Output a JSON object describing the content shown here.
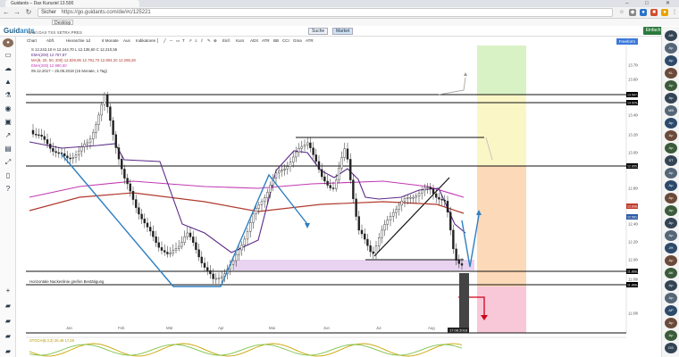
{
  "browser": {
    "tab_title": "Guidants – Dax Kursziel 13.500",
    "url": "https://go.guidants.com/de/#c/125221",
    "secure_label": "Sicher",
    "bookmarks": [
      "Desktop"
    ]
  },
  "site": {
    "logo_a": "Guid",
    "logo_b": "ants",
    "search_label": "Suche",
    "active_button": "Market",
    "login_label": "Einfach Login"
  },
  "chart_window": {
    "title": "Chart DAX TXX XETRA PRES",
    "toolbar": {
      "items": [
        "Chart",
        "Abfl.",
        "Hierarchie",
        "1d",
        "6 Monate",
        "Aus",
        "Indikatoren"
      ],
      "tools": [
        "Einf.",
        "Kurs",
        "ADX",
        "ATR",
        "BB",
        "CCI",
        "Gma",
        "ATR"
      ],
      "freeze_label": "Freeform"
    },
    "legend": [
      "S 12.242,10  H 12.244,70  L 12.135,60  C 12.210,55",
      "EMA(200)  12.757,87",
      "MA(8, 20, 50, 200)  12.829,95  12.791,70  12.804,20  12.286,28",
      "EMA(200)  12.990,50",
      "09.12.2017 – 25.08.2018  (15 Monate, 1 Tag)"
    ],
    "annotation": "Horizontale Nackenlinie greifen Bestätigung",
    "date_labels": [
      "Jan",
      "Feb",
      "Mär",
      "Apr",
      "Mai",
      "Jun",
      "Jul",
      "Aug"
    ],
    "date_marker": "17.08.2018",
    "price_labels": [
      "13.700,00",
      "13.600,00",
      "13.400,00",
      "13.200,00",
      "13.000,00",
      "12.800,00",
      "12.600,00",
      "12.400,00",
      "12.200,00",
      "12.000,00",
      "11.800,00",
      "11.600,00"
    ],
    "level_tags": [
      {
        "label": "13.597,70",
        "color": "#000000"
      },
      {
        "label": "13.525,00",
        "color": "#000000"
      },
      {
        "label": "12.855,00",
        "color": "#000000"
      },
      {
        "label": "12.698,35",
        "color": "#c0392b"
      },
      {
        "label": "12.581,71",
        "color": "#2e5aa8"
      },
      {
        "label": "11.868,00",
        "color": "#000000"
      },
      {
        "label": "11.868,00",
        "color": "#000000"
      }
    ],
    "oscillator_label": "STOCH(8,3,3)  20,49  17,26"
  },
  "colors": {
    "ema_purple": "#5b2a86",
    "ma_red": "#b03a2e",
    "ma_pink": "#c239b3",
    "trend_blue": "#2f7fc1",
    "zone_green": "#d9f2c5",
    "zone_yellow": "#fbf6c6",
    "zone_orange": "#fcd9b8",
    "zone_pink": "#f9c8d8",
    "support_band": "#e8d3f0"
  },
  "left_icons": [
    "user-avatar-icon",
    "monitor-icon",
    "cloud-icon",
    "lock-icon",
    "flask-icon",
    "eye-icon",
    "watchlist-icon",
    "chart-icon",
    "sheet-icon",
    "expand-icon",
    "doc-icon",
    "help-icon",
    "plus-icon",
    "folder-icon",
    "folder-icon",
    "folder-icon",
    "folder-icon"
  ],
  "right_users": [
    "AB",
    "Ap",
    "Ap",
    "KL",
    "Ap",
    "Ap",
    "MB",
    "Ap",
    "Ap",
    "Ap",
    "ST",
    "Ap",
    "Ap",
    "Ap",
    "Ap",
    "Ap",
    "Ap",
    "JH",
    "Ap",
    "AK",
    "Ap",
    "Ap",
    "AP",
    "Ap",
    "Ap",
    "DS"
  ]
}
